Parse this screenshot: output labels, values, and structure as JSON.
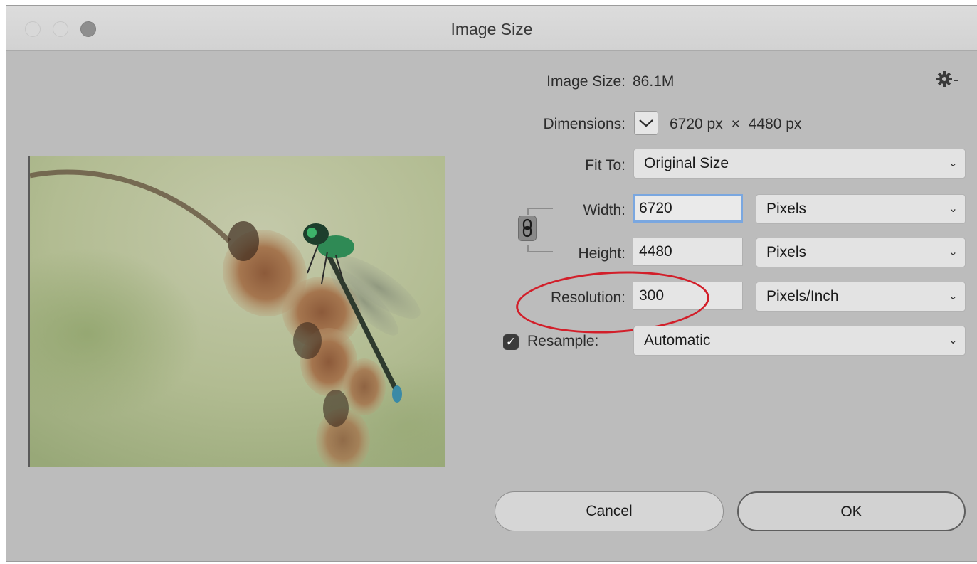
{
  "window": {
    "title": "Image Size"
  },
  "image_size": {
    "label": "Image Size:",
    "value": "86.1M"
  },
  "dimensions": {
    "label": "Dimensions:",
    "width": "6720 px",
    "separator": "×",
    "height": "4480 px"
  },
  "fit_to": {
    "label": "Fit To:",
    "value": "Original Size"
  },
  "width": {
    "label": "Width:",
    "value": "6720",
    "unit": "Pixels"
  },
  "height": {
    "label": "Height:",
    "value": "4480",
    "unit": "Pixels"
  },
  "resolution": {
    "label": "Resolution:",
    "value": "300",
    "unit": "Pixels/Inch"
  },
  "resample": {
    "label": "Resample:",
    "checked": true,
    "value": "Automatic"
  },
  "buttons": {
    "cancel": "Cancel",
    "ok": "OK"
  },
  "annotation": {
    "color": "#d21f2a"
  },
  "icons": {
    "settings": "gear-icon",
    "link": "chain-link-icon",
    "dimensions_toggle": "chevron-down-icon"
  }
}
